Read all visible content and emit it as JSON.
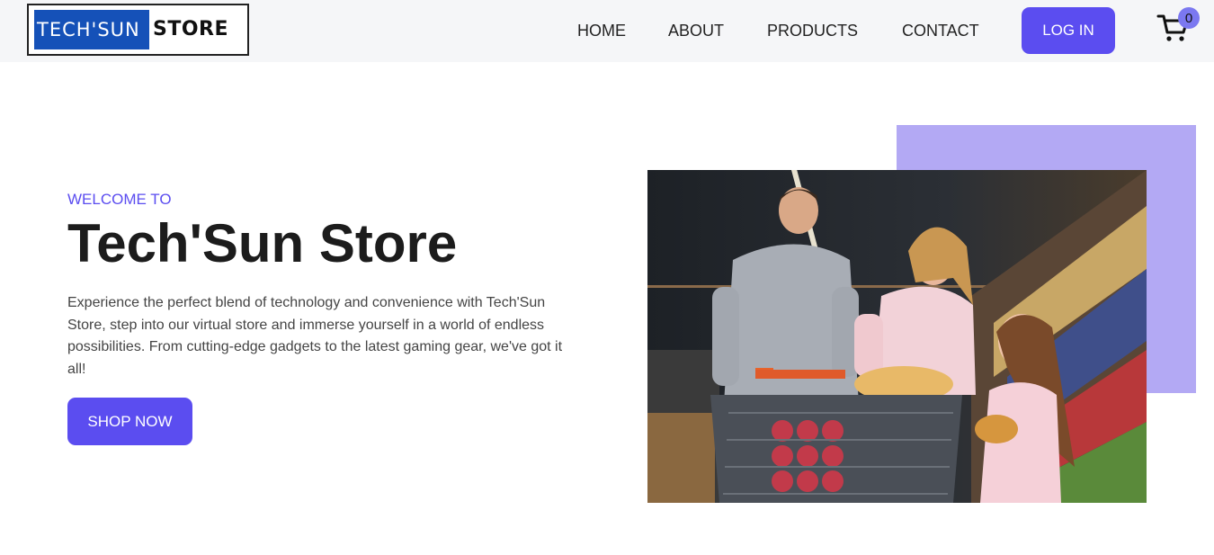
{
  "header": {
    "logo": {
      "part1": "TECH'SUN",
      "part2": "STORE"
    },
    "nav": [
      "HOME",
      "ABOUT",
      "PRODUCTS",
      "CONTACT"
    ],
    "login_label": "LOG IN",
    "cart": {
      "icon": "cart-icon",
      "count": "0"
    }
  },
  "hero": {
    "pretitle": "WELCOME TO",
    "title": "Tech'Sun Store",
    "description": "Experience the perfect blend of technology and convenience with Tech'Sun Store, step into our virtual store and immerse yourself in a world of endless possibilities. From cutting-edge gadgets to the latest gaming gear, we've got it all!",
    "cta_label": "SHOP NOW"
  },
  "colors": {
    "accent": "#5b4df0",
    "accent_light": "#b3a9f4",
    "nav_bg": "#f5f6f8",
    "logo_blue": "#1551b8"
  }
}
